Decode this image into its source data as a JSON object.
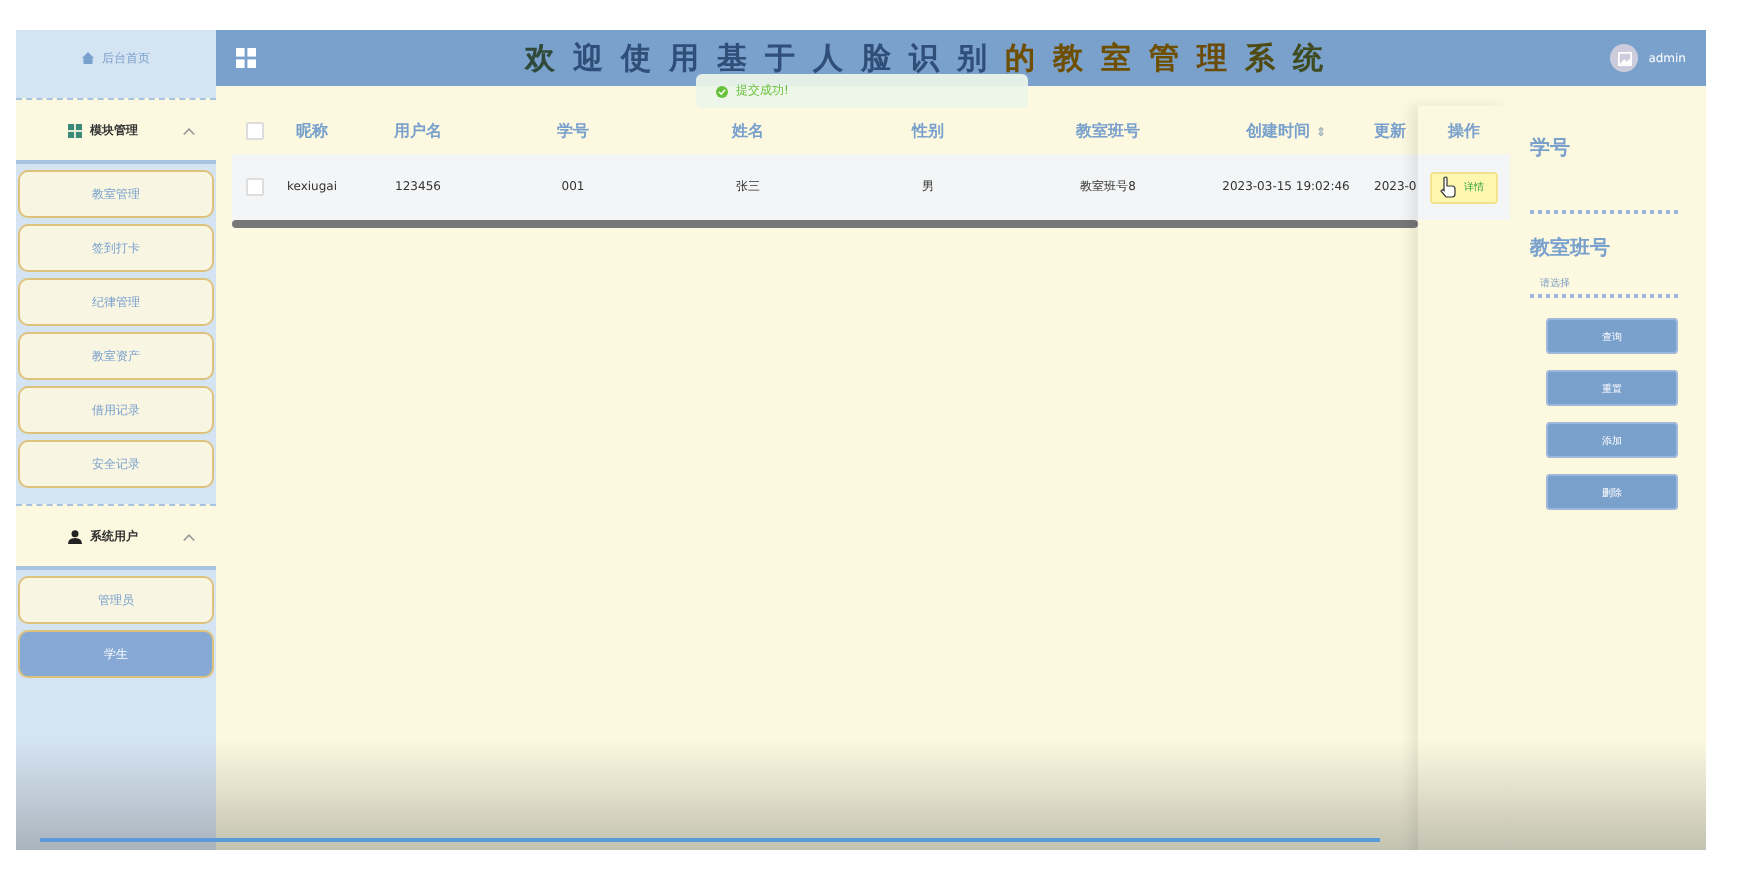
{
  "sidebar": {
    "home": {
      "label": "后台首页"
    },
    "groups": [
      {
        "label": "模块管理",
        "expanded": true,
        "items": [
          {
            "label": "教室管理",
            "selected": false
          },
          {
            "label": "签到打卡",
            "selected": false
          },
          {
            "label": "纪律管理",
            "selected": false
          },
          {
            "label": "教室资产",
            "selected": false
          },
          {
            "label": "借用记录",
            "selected": false
          },
          {
            "label": "安全记录",
            "selected": false
          }
        ]
      },
      {
        "label": "系统用户",
        "expanded": true,
        "items": [
          {
            "label": "管理员",
            "selected": false
          },
          {
            "label": "学生",
            "selected": true
          }
        ]
      }
    ]
  },
  "header": {
    "title": "欢迎使用基于人脸识别的教室管理系统",
    "user": "admin"
  },
  "toast": {
    "text": "提交成功!"
  },
  "table": {
    "select_all": {
      "checked": false
    },
    "columns": [
      {
        "label": "昵称"
      },
      {
        "label": "用户名"
      },
      {
        "label": "学号"
      },
      {
        "label": "姓名"
      },
      {
        "label": "性别"
      },
      {
        "label": "教室班号"
      },
      {
        "label": "创建时间",
        "sort_icon": "⇕"
      },
      {
        "label": "更新"
      }
    ],
    "action_column": "操作",
    "rows": [
      {
        "checked": false,
        "cells": [
          "kexiugai",
          "123456",
          "001",
          "张三",
          "男",
          "教室班号8",
          "2023-03-15 19:02:46",
          "2023-0"
        ],
        "action": "详情"
      }
    ]
  },
  "search": {
    "fields": [
      {
        "label": "学号",
        "kind": "input"
      },
      {
        "label": "教室班号",
        "kind": "select",
        "placeholder": "请选择"
      }
    ],
    "buttons": [
      "查询",
      "重置",
      "添加",
      "删除"
    ]
  }
}
